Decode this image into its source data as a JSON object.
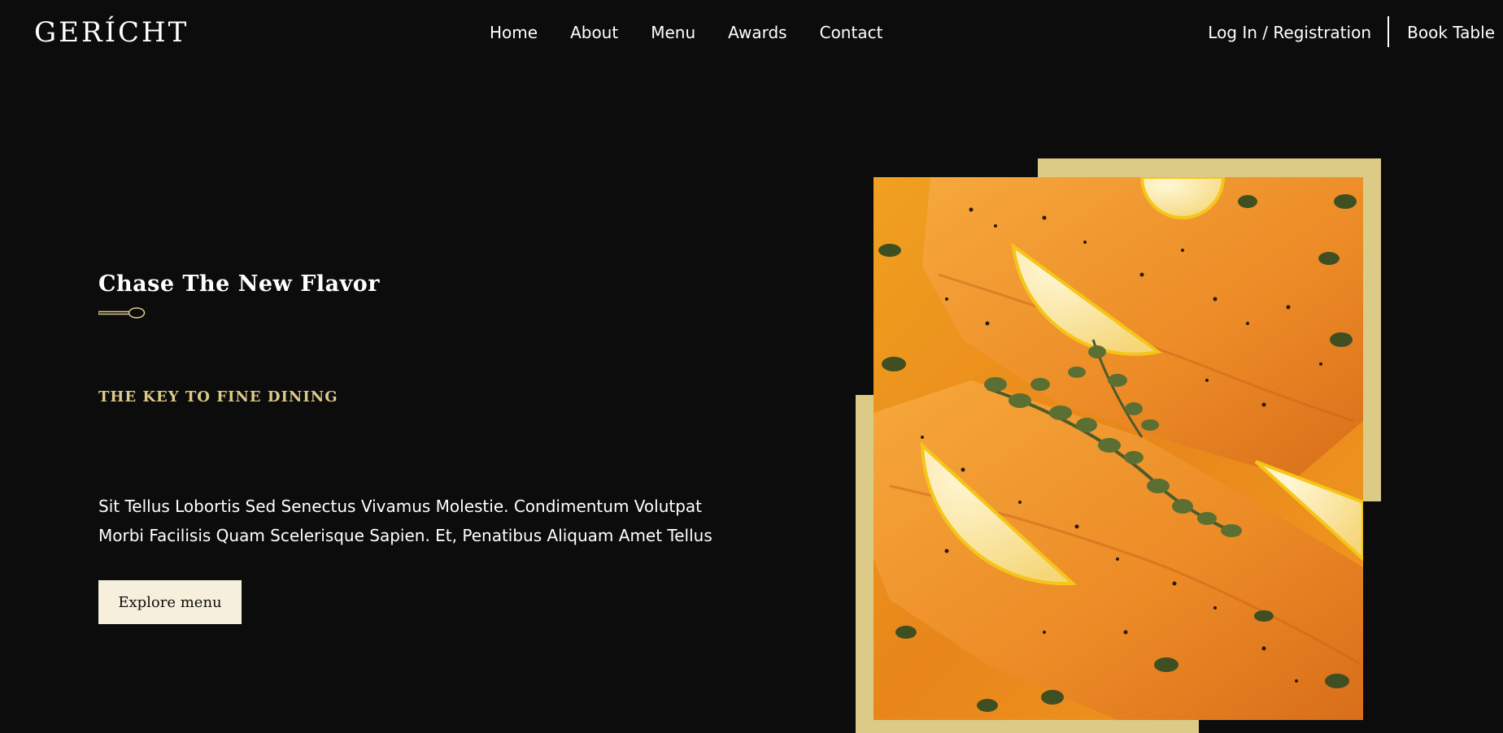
{
  "header": {
    "logo": "GERÍCHT",
    "nav": [
      "Home",
      "About",
      "Menu",
      "Awards",
      "Contact"
    ],
    "login_label": "Log In / Registration",
    "book_label": "Book Table"
  },
  "hero": {
    "heading": "Chase The New Flavor",
    "subtitle": "THE KEY TO FINE DINING",
    "description": "Sit Tellus Lobortis Sed Senectus Vivamus Molestie. Condimentum Volutpat Morbi Facilisis Quam Scelerisque Sapien. Et, Penatibus Aliquam Amet Tellus",
    "cta_label": "Explore menu"
  },
  "colors": {
    "background": "#0c0c0c",
    "accent_gold": "#dcca87",
    "button_bg": "#f5efdb",
    "text": "#ffffff"
  },
  "icons": [
    "spoon-icon"
  ]
}
